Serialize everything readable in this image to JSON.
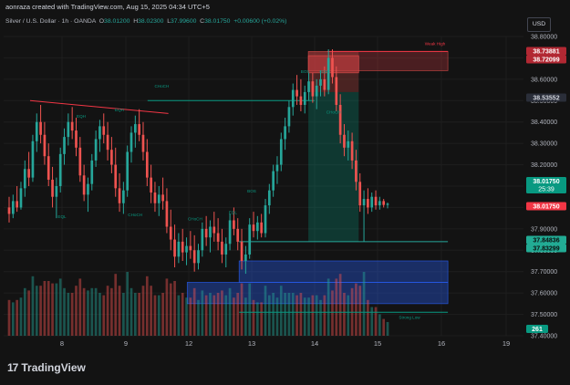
{
  "header": {
    "caption": "aonraza created with TradingView.com, Aug 15, 2025 04:34 UTC+5"
  },
  "legend": {
    "symbol": "Silver / U.S. Dollar · 1h · OANDA",
    "o_label": "O",
    "o": "38.01200",
    "h_label": "H",
    "h": "38.02300",
    "l_label": "L",
    "l": "37.99600",
    "c_label": "C",
    "c": "38.01750",
    "change": "+0.00600 (+0.02%)"
  },
  "currency_button": "USD",
  "brand": {
    "name": "TradingView",
    "mark": "17"
  },
  "colors": {
    "background": "#131313",
    "up": "#26a69a",
    "down": "#ef5350",
    "annotation": "#089981",
    "demand_zone": "#2962ff",
    "supply_zone": "#b2353b",
    "grid": "#1e1e1e"
  },
  "chart_data": {
    "type": "candlestick",
    "timeframe": "1h",
    "x_ticks": [
      "8",
      "9",
      "12",
      "13",
      "14",
      "15",
      "16",
      "19"
    ],
    "y_ticks": [
      "38.80000",
      "38.70000",
      "38.60000",
      "38.50000",
      "38.40000",
      "38.30000",
      "38.20000",
      "38.10000",
      "38.00000",
      "37.90000",
      "37.80000",
      "37.70000",
      "37.60000",
      "37.50000",
      "37.40000"
    ],
    "ylim": [
      37.4,
      38.8
    ],
    "price_tags": [
      {
        "value": 38.73881,
        "label": "38.73881",
        "style": "supply"
      },
      {
        "value": 38.72099,
        "label": "38.72099",
        "style": "supply"
      },
      {
        "value": 38.53552,
        "label": "38.53552",
        "style": "neutral"
      },
      {
        "value": 38.0175,
        "label": "38.01750",
        "style": "current-up",
        "countdown": "25:39"
      },
      {
        "value": 38.0175,
        "label": "38.01750",
        "style": "current-down"
      },
      {
        "value": 37.84836,
        "label": "37.84836",
        "style": "green"
      },
      {
        "value": 37.83299,
        "label": "37.83299",
        "style": "green"
      }
    ],
    "volume_tag": "261",
    "annotations": [
      {
        "text": "CHoCH",
        "x": 10.3,
        "y": 38.56
      },
      {
        "text": "Weak High",
        "x": 15.9,
        "y": 38.76
      },
      {
        "text": "Strong Low",
        "x": 15.5,
        "y": 37.48
      },
      {
        "text": "EQL",
        "x": 8.0,
        "y": 37.95
      },
      {
        "text": "EQH",
        "x": 8.3,
        "y": 38.42
      },
      {
        "text": "EQH",
        "x": 8.9,
        "y": 38.45
      },
      {
        "text": "CHoCH",
        "x": 9.3,
        "y": 37.96
      },
      {
        "text": "CHoCH",
        "x": 12.1,
        "y": 37.94
      },
      {
        "text": "EQL",
        "x": 12.7,
        "y": 37.97
      },
      {
        "text": "BOS",
        "x": 13.0,
        "y": 38.07
      },
      {
        "text": "BOS",
        "x": 13.85,
        "y": 38.63
      },
      {
        "text": "EQH",
        "x": 14.15,
        "y": 38.63
      },
      {
        "text": "CHoCH",
        "x": 14.3,
        "y": 38.44
      }
    ],
    "zones": [
      {
        "kind": "supply",
        "x0": 13.9,
        "x1": 16.3,
        "y0": 38.64,
        "y1": 38.73
      },
      {
        "kind": "supply-small",
        "x0": 13.9,
        "x1": 14.7,
        "y0": 38.63,
        "y1": 38.71
      },
      {
        "kind": "short-loss",
        "x0": 13.9,
        "x1": 14.7,
        "y0": 38.54,
        "y1": 38.73
      },
      {
        "kind": "short-profit",
        "x0": 13.9,
        "x1": 14.7,
        "y0": 37.84,
        "y1": 38.54
      },
      {
        "kind": "demand",
        "x0": 12.8,
        "x1": 16.3,
        "y0": 37.65,
        "y1": 37.75
      },
      {
        "kind": "demand",
        "x0": 11.9,
        "x1": 16.3,
        "y0": 37.55,
        "y1": 37.65
      }
    ],
    "lines": [
      {
        "kind": "trend",
        "x0": 7.5,
        "y0": 38.5,
        "x1": 10.7,
        "y1": 38.44
      },
      {
        "kind": "choch",
        "x0": 9.7,
        "y0": 38.5,
        "x1": 14.0,
        "y1": 38.5
      },
      {
        "kind": "level",
        "x0": 12.8,
        "y0": 37.84,
        "x1": 16.3,
        "y1": 37.84
      },
      {
        "kind": "weak-high",
        "x0": 14.2,
        "y0": 38.73,
        "x1": 16.3,
        "y1": 38.73
      },
      {
        "kind": "strong-low",
        "x0": 12.8,
        "y0": 37.51,
        "x1": 16.3,
        "y1": 37.51
      }
    ],
    "candles": [
      {
        "o": 38.0,
        "h": 38.05,
        "l": 37.93,
        "c": 37.97
      },
      {
        "o": 37.97,
        "h": 38.06,
        "l": 37.95,
        "c": 38.03
      },
      {
        "o": 38.03,
        "h": 38.1,
        "l": 37.98,
        "c": 38.0
      },
      {
        "o": 38.0,
        "h": 38.12,
        "l": 37.99,
        "c": 38.09
      },
      {
        "o": 38.09,
        "h": 38.22,
        "l": 38.05,
        "c": 38.18
      },
      {
        "o": 38.18,
        "h": 38.26,
        "l": 38.1,
        "c": 38.14
      },
      {
        "o": 38.14,
        "h": 38.34,
        "l": 38.12,
        "c": 38.31
      },
      {
        "o": 38.31,
        "h": 38.44,
        "l": 38.26,
        "c": 38.4
      },
      {
        "o": 38.4,
        "h": 38.48,
        "l": 38.3,
        "c": 38.34
      },
      {
        "o": 38.34,
        "h": 38.4,
        "l": 38.2,
        "c": 38.24
      },
      {
        "o": 38.24,
        "h": 38.3,
        "l": 38.1,
        "c": 38.13
      },
      {
        "o": 38.13,
        "h": 38.19,
        "l": 38.0,
        "c": 38.05
      },
      {
        "o": 38.05,
        "h": 38.14,
        "l": 37.95,
        "c": 38.1
      },
      {
        "o": 38.1,
        "h": 38.28,
        "l": 38.07,
        "c": 38.25
      },
      {
        "o": 38.25,
        "h": 38.37,
        "l": 38.2,
        "c": 38.33
      },
      {
        "o": 38.33,
        "h": 38.44,
        "l": 38.29,
        "c": 38.4
      },
      {
        "o": 38.4,
        "h": 38.47,
        "l": 38.32,
        "c": 38.36
      },
      {
        "o": 38.36,
        "h": 38.42,
        "l": 38.24,
        "c": 38.28
      },
      {
        "o": 38.28,
        "h": 38.33,
        "l": 38.12,
        "c": 38.15
      },
      {
        "o": 38.15,
        "h": 38.2,
        "l": 38.03,
        "c": 38.06
      },
      {
        "o": 38.06,
        "h": 38.14,
        "l": 37.98,
        "c": 38.11
      },
      {
        "o": 38.11,
        "h": 38.25,
        "l": 38.08,
        "c": 38.22
      },
      {
        "o": 38.22,
        "h": 38.36,
        "l": 38.19,
        "c": 38.32
      },
      {
        "o": 38.32,
        "h": 38.41,
        "l": 38.26,
        "c": 38.38
      },
      {
        "o": 38.38,
        "h": 38.44,
        "l": 38.3,
        "c": 38.34
      },
      {
        "o": 38.34,
        "h": 38.4,
        "l": 38.22,
        "c": 38.27
      },
      {
        "o": 38.27,
        "h": 38.33,
        "l": 38.16,
        "c": 38.2
      },
      {
        "o": 38.2,
        "h": 38.28,
        "l": 38.05,
        "c": 38.09
      },
      {
        "o": 38.09,
        "h": 38.16,
        "l": 37.98,
        "c": 38.02
      },
      {
        "o": 38.02,
        "h": 38.12,
        "l": 37.97,
        "c": 38.08
      },
      {
        "o": 38.08,
        "h": 38.29,
        "l": 38.05,
        "c": 38.26
      },
      {
        "o": 38.26,
        "h": 38.38,
        "l": 38.21,
        "c": 38.35
      },
      {
        "o": 38.35,
        "h": 38.43,
        "l": 38.28,
        "c": 38.39
      },
      {
        "o": 38.39,
        "h": 38.46,
        "l": 38.31,
        "c": 38.34
      },
      {
        "o": 38.34,
        "h": 38.4,
        "l": 38.22,
        "c": 38.26
      },
      {
        "o": 38.26,
        "h": 38.32,
        "l": 38.1,
        "c": 38.14
      },
      {
        "o": 38.14,
        "h": 38.2,
        "l": 38.02,
        "c": 38.07
      },
      {
        "o": 38.07,
        "h": 38.12,
        "l": 37.98,
        "c": 38.02
      },
      {
        "o": 38.02,
        "h": 38.1,
        "l": 37.96,
        "c": 38.06
      },
      {
        "o": 38.06,
        "h": 38.14,
        "l": 37.99,
        "c": 38.03
      },
      {
        "o": 38.03,
        "h": 38.09,
        "l": 37.88,
        "c": 37.91
      },
      {
        "o": 37.91,
        "h": 37.99,
        "l": 37.8,
        "c": 37.85
      },
      {
        "o": 37.85,
        "h": 37.92,
        "l": 37.72,
        "c": 37.77
      },
      {
        "o": 37.77,
        "h": 37.88,
        "l": 37.74,
        "c": 37.84
      },
      {
        "o": 37.84,
        "h": 37.9,
        "l": 37.75,
        "c": 37.79
      },
      {
        "o": 37.79,
        "h": 37.86,
        "l": 37.73,
        "c": 37.82
      },
      {
        "o": 37.82,
        "h": 37.89,
        "l": 37.76,
        "c": 37.8
      },
      {
        "o": 37.8,
        "h": 37.87,
        "l": 37.7,
        "c": 37.74
      },
      {
        "o": 37.74,
        "h": 37.83,
        "l": 37.71,
        "c": 37.8
      },
      {
        "o": 37.8,
        "h": 37.93,
        "l": 37.77,
        "c": 37.9
      },
      {
        "o": 37.9,
        "h": 37.96,
        "l": 37.82,
        "c": 37.86
      },
      {
        "o": 37.86,
        "h": 37.94,
        "l": 37.79,
        "c": 37.91
      },
      {
        "o": 37.91,
        "h": 37.98,
        "l": 37.84,
        "c": 37.88
      },
      {
        "o": 37.88,
        "h": 37.95,
        "l": 37.8,
        "c": 37.84
      },
      {
        "o": 37.84,
        "h": 37.9,
        "l": 37.74,
        "c": 37.78
      },
      {
        "o": 37.78,
        "h": 37.86,
        "l": 37.72,
        "c": 37.83
      },
      {
        "o": 37.83,
        "h": 37.97,
        "l": 37.8,
        "c": 37.94
      },
      {
        "o": 37.94,
        "h": 38.0,
        "l": 37.87,
        "c": 37.9
      },
      {
        "o": 37.9,
        "h": 37.95,
        "l": 37.8,
        "c": 37.84
      },
      {
        "o": 37.84,
        "h": 37.9,
        "l": 37.71,
        "c": 37.75
      },
      {
        "o": 37.75,
        "h": 37.82,
        "l": 37.69,
        "c": 37.78
      },
      {
        "o": 37.78,
        "h": 37.95,
        "l": 37.76,
        "c": 37.92
      },
      {
        "o": 37.92,
        "h": 37.98,
        "l": 37.86,
        "c": 37.89
      },
      {
        "o": 37.89,
        "h": 37.96,
        "l": 37.85,
        "c": 37.93
      },
      {
        "o": 37.93,
        "h": 37.97,
        "l": 37.86,
        "c": 37.88
      },
      {
        "o": 37.88,
        "h": 38.04,
        "l": 37.86,
        "c": 38.01
      },
      {
        "o": 38.01,
        "h": 38.11,
        "l": 37.97,
        "c": 38.08
      },
      {
        "o": 38.08,
        "h": 38.2,
        "l": 38.05,
        "c": 38.17
      },
      {
        "o": 38.17,
        "h": 38.24,
        "l": 38.11,
        "c": 38.2
      },
      {
        "o": 38.2,
        "h": 38.35,
        "l": 38.17,
        "c": 38.32
      },
      {
        "o": 38.32,
        "h": 38.42,
        "l": 38.27,
        "c": 38.38
      },
      {
        "o": 38.38,
        "h": 38.5,
        "l": 38.35,
        "c": 38.47
      },
      {
        "o": 38.47,
        "h": 38.58,
        "l": 38.43,
        "c": 38.55
      },
      {
        "o": 38.55,
        "h": 38.62,
        "l": 38.48,
        "c": 38.52
      },
      {
        "o": 38.52,
        "h": 38.6,
        "l": 38.45,
        "c": 38.48
      },
      {
        "o": 38.48,
        "h": 38.57,
        "l": 38.44,
        "c": 38.54
      },
      {
        "o": 38.54,
        "h": 38.63,
        "l": 38.5,
        "c": 38.59
      },
      {
        "o": 38.59,
        "h": 38.63,
        "l": 38.49,
        "c": 38.52
      },
      {
        "o": 38.52,
        "h": 38.6,
        "l": 38.46,
        "c": 38.57
      },
      {
        "o": 38.57,
        "h": 38.64,
        "l": 38.52,
        "c": 38.6
      },
      {
        "o": 38.6,
        "h": 38.66,
        "l": 38.52,
        "c": 38.55
      },
      {
        "o": 38.55,
        "h": 38.74,
        "l": 38.53,
        "c": 38.7
      },
      {
        "o": 38.7,
        "h": 38.74,
        "l": 38.58,
        "c": 38.61
      },
      {
        "o": 38.61,
        "h": 38.66,
        "l": 38.45,
        "c": 38.48
      },
      {
        "o": 38.48,
        "h": 38.53,
        "l": 38.3,
        "c": 38.34
      },
      {
        "o": 38.34,
        "h": 38.39,
        "l": 38.24,
        "c": 38.28
      },
      {
        "o": 38.28,
        "h": 38.36,
        "l": 38.22,
        "c": 38.31
      },
      {
        "o": 38.31,
        "h": 38.35,
        "l": 38.18,
        "c": 38.22
      },
      {
        "o": 38.22,
        "h": 38.27,
        "l": 38.08,
        "c": 38.12
      },
      {
        "o": 38.12,
        "h": 38.16,
        "l": 37.98,
        "c": 38.01
      },
      {
        "o": 38.01,
        "h": 38.08,
        "l": 37.84,
        "c": 38.04
      },
      {
        "o": 38.04,
        "h": 38.09,
        "l": 37.97,
        "c": 38.0
      },
      {
        "o": 38.0,
        "h": 38.07,
        "l": 37.98,
        "c": 38.05
      },
      {
        "o": 38.05,
        "h": 38.08,
        "l": 37.99,
        "c": 38.01
      },
      {
        "o": 38.01,
        "h": 38.05,
        "l": 37.99,
        "c": 38.03
      },
      {
        "o": 38.03,
        "h": 38.04,
        "l": 38.0,
        "c": 38.012
      },
      {
        "o": 38.012,
        "h": 38.023,
        "l": 37.996,
        "c": 38.0175
      }
    ]
  }
}
